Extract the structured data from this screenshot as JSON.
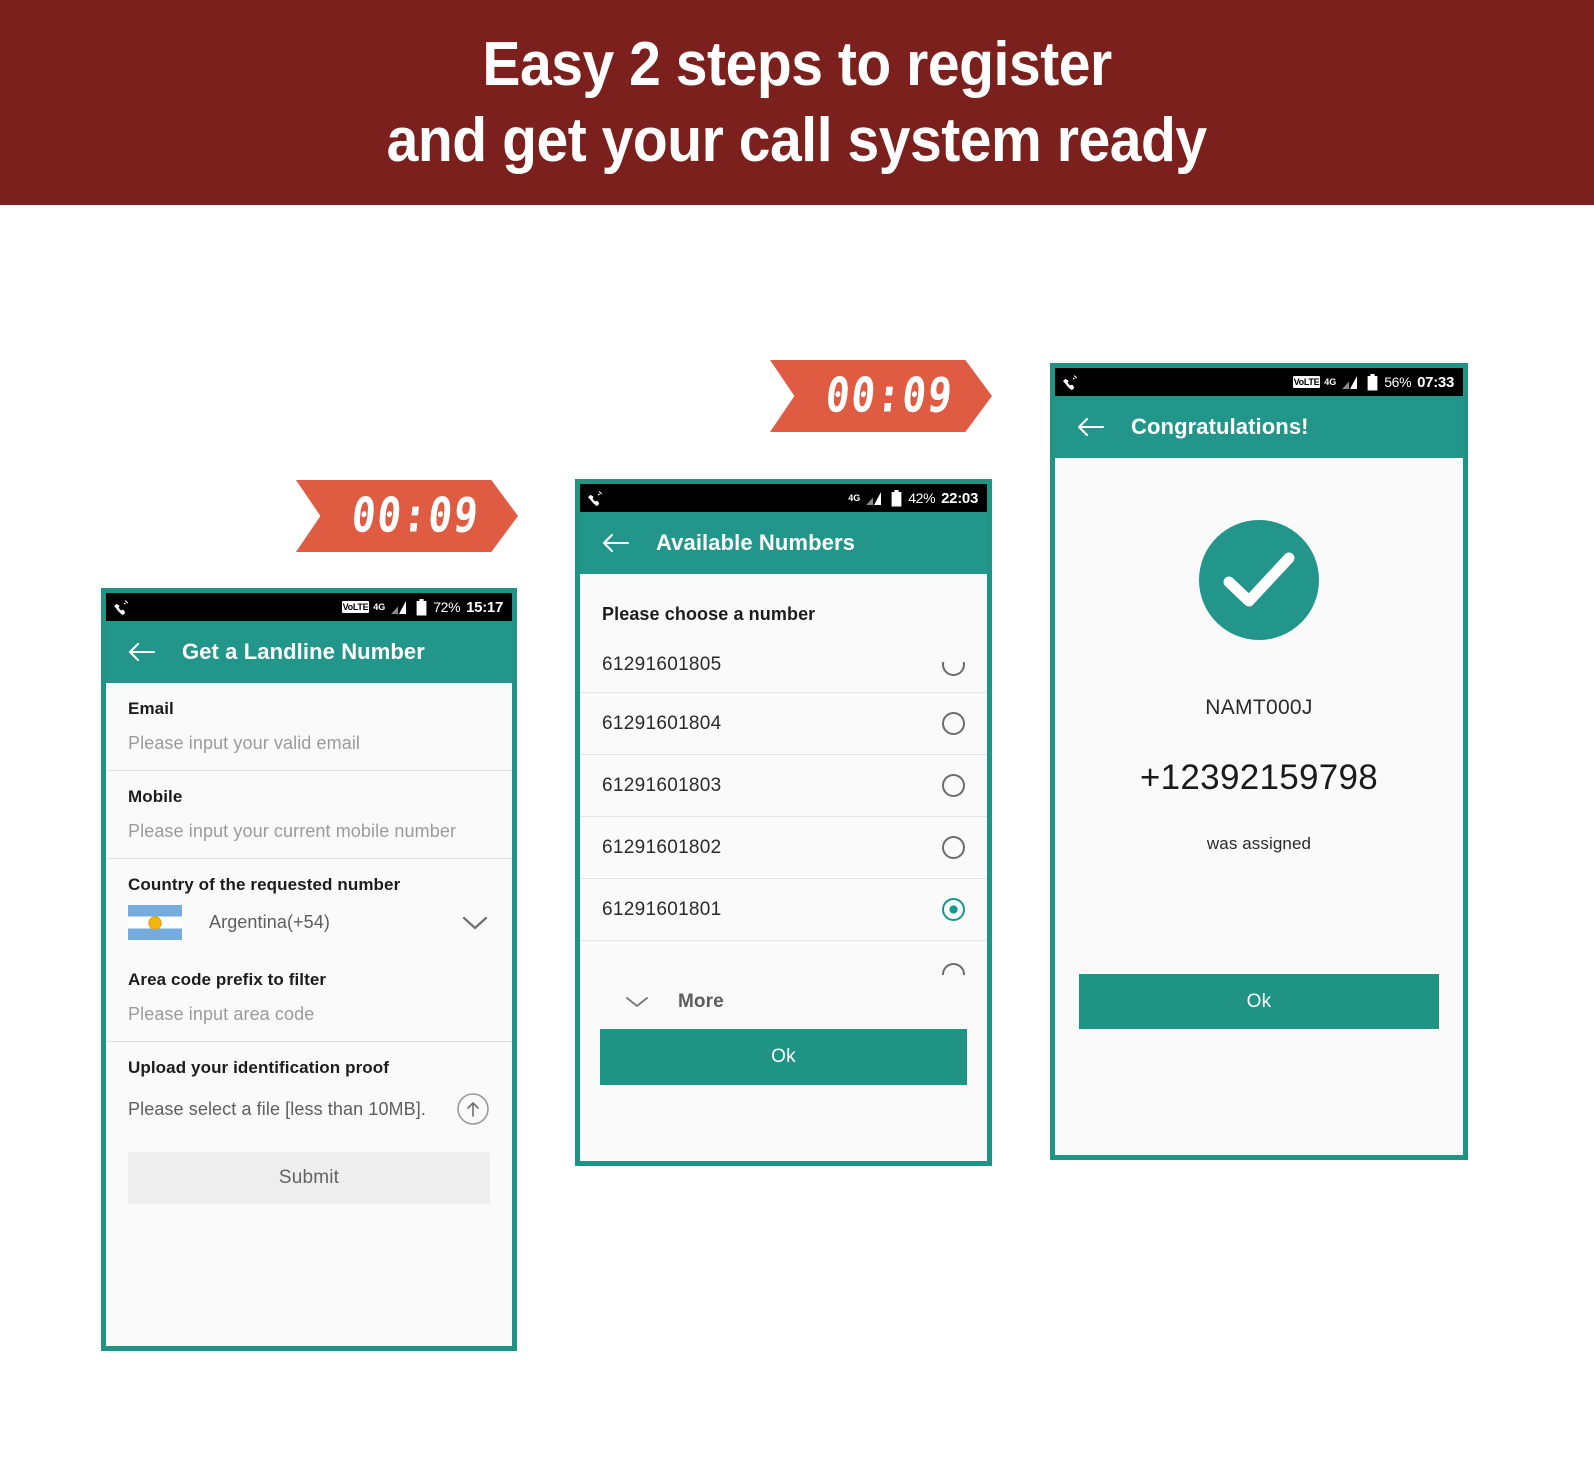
{
  "header": {
    "line1": "Easy 2 steps to register",
    "line2": "and get your call system ready",
    "background_color": "#7b201c",
    "text_color": "#ffffff"
  },
  "theme": {
    "teal": "#22968b",
    "teal_dark": "#1f9485",
    "badge_red": "#df5b42",
    "body_bg": "#fafafa"
  },
  "badges": [
    {
      "name": "timer-badge-step-1",
      "time": "00:09"
    },
    {
      "name": "timer-badge-step-2",
      "time": "00:09"
    }
  ],
  "phone1": {
    "statusbar": {
      "call_icon": "phone-call-icon",
      "volte": "VoLTE",
      "network": "4G",
      "signal_icon": "signal-bars-icon",
      "battery_icon": "battery-icon",
      "battery_percent": "72%",
      "time": "15:17"
    },
    "appbar": {
      "back_icon": "back-arrow-icon",
      "title": "Get a Landline Number"
    },
    "fields": [
      {
        "label": "Email",
        "placeholder": "Please input your valid email",
        "value": ""
      },
      {
        "label": "Mobile",
        "placeholder": "Please input your current mobile number",
        "value": ""
      }
    ],
    "country": {
      "label": "Country of the requested number",
      "flag_icon": "argentina-flag-icon",
      "selected": "Argentina(+54)",
      "chevron_icon": "chevron-down-icon",
      "options": [
        "Argentina(+54)"
      ]
    },
    "area_code": {
      "label": "Area code prefix to filter",
      "placeholder": "Please input area code",
      "value": ""
    },
    "upload": {
      "label": "Upload your identification proof",
      "hint": "Please select a file [less than 10MB].",
      "button_icon": "upload-arrow-icon"
    },
    "submit_label": "Submit"
  },
  "phone2": {
    "statusbar": {
      "call_icon": "phone-call-icon",
      "volte": "",
      "network": "4G",
      "signal_icon": "signal-bars-icon",
      "battery_icon": "battery-icon",
      "battery_percent": "42%",
      "time": "22:03"
    },
    "appbar": {
      "back_icon": "back-arrow-icon",
      "title": "Available Numbers"
    },
    "list_title": "Please choose a number",
    "numbers": [
      {
        "number": "61291601805",
        "selected": false
      },
      {
        "number": "61291601804",
        "selected": false
      },
      {
        "number": "61291601803",
        "selected": false
      },
      {
        "number": "61291601802",
        "selected": false
      },
      {
        "number": "61291601801",
        "selected": true
      }
    ],
    "more": {
      "icon": "chevron-down-icon",
      "label": "More"
    },
    "ok_label": "Ok"
  },
  "phone3": {
    "statusbar": {
      "call_icon": "phone-call-icon",
      "volte": "VoLTE",
      "network": "4G",
      "signal_icon": "signal-bars-icon",
      "battery_icon": "battery-icon",
      "battery_percent": "56%",
      "time": "07:33"
    },
    "appbar": {
      "back_icon": "back-arrow-icon",
      "title": "Congratulations!"
    },
    "success_icon": "check-circle-icon",
    "code": "NAMT000J",
    "assigned_number": "+12392159798",
    "assigned_caption": "was assigned",
    "ok_label": "Ok"
  }
}
